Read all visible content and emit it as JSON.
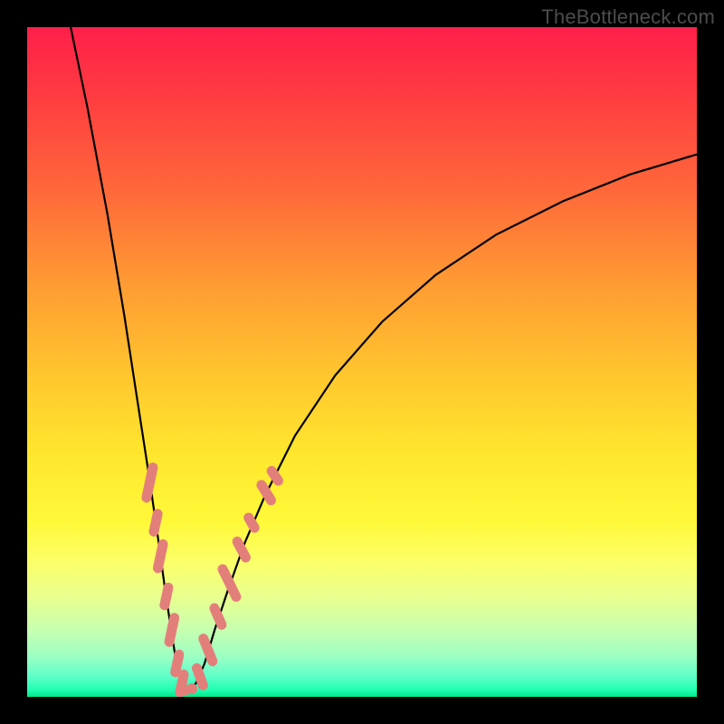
{
  "watermark": "TheBottleneck.com",
  "chart_data": {
    "type": "line",
    "title": "",
    "xlabel": "",
    "ylabel": "",
    "xlim": [
      0,
      100
    ],
    "ylim": [
      0,
      100
    ],
    "grid": false,
    "curve": {
      "description": "V-shaped bottleneck curve; minimum near x≈23, rising asymmetrically",
      "points": [
        {
          "x": 6.5,
          "y": 100
        },
        {
          "x": 9,
          "y": 88
        },
        {
          "x": 12,
          "y": 72
        },
        {
          "x": 14.5,
          "y": 57
        },
        {
          "x": 16.5,
          "y": 44
        },
        {
          "x": 18.2,
          "y": 33
        },
        {
          "x": 19.5,
          "y": 24
        },
        {
          "x": 20.6,
          "y": 16
        },
        {
          "x": 21.5,
          "y": 10
        },
        {
          "x": 22.3,
          "y": 5
        },
        {
          "x": 23.0,
          "y": 2
        },
        {
          "x": 24.0,
          "y": 1
        },
        {
          "x": 25.2,
          "y": 2
        },
        {
          "x": 26.5,
          "y": 5
        },
        {
          "x": 28.0,
          "y": 10
        },
        {
          "x": 30.0,
          "y": 16
        },
        {
          "x": 32.5,
          "y": 23
        },
        {
          "x": 35.5,
          "y": 30
        },
        {
          "x": 40.0,
          "y": 39
        },
        {
          "x": 46.0,
          "y": 48
        },
        {
          "x": 53.0,
          "y": 56
        },
        {
          "x": 61.0,
          "y": 63
        },
        {
          "x": 70.0,
          "y": 69
        },
        {
          "x": 80.0,
          "y": 74
        },
        {
          "x": 90.0,
          "y": 78
        },
        {
          "x": 100.0,
          "y": 81
        }
      ]
    },
    "markers": {
      "color": "#e37f7a",
      "left_branch": [
        {
          "x": 18.3,
          "y": 32,
          "len": 5
        },
        {
          "x": 19.2,
          "y": 26,
          "len": 3
        },
        {
          "x": 19.9,
          "y": 21,
          "len": 4
        },
        {
          "x": 20.8,
          "y": 15,
          "len": 3
        },
        {
          "x": 21.6,
          "y": 10,
          "len": 4
        },
        {
          "x": 22.4,
          "y": 5,
          "len": 3
        },
        {
          "x": 23.1,
          "y": 2,
          "len": 3
        }
      ],
      "bottom": [
        {
          "x": 23.6,
          "y": 1
        },
        {
          "x": 24.6,
          "y": 1.2
        }
      ],
      "right_branch": [
        {
          "x": 25.8,
          "y": 3,
          "len": 3
        },
        {
          "x": 27.0,
          "y": 7,
          "len": 4
        },
        {
          "x": 28.5,
          "y": 12,
          "len": 3
        },
        {
          "x": 30.2,
          "y": 17,
          "len": 5
        },
        {
          "x": 32.0,
          "y": 22,
          "len": 3
        },
        {
          "x": 33.5,
          "y": 26,
          "len": 2
        },
        {
          "x": 35.7,
          "y": 30.5,
          "len": 3
        },
        {
          "x": 37.0,
          "y": 33,
          "len": 2
        }
      ]
    }
  }
}
